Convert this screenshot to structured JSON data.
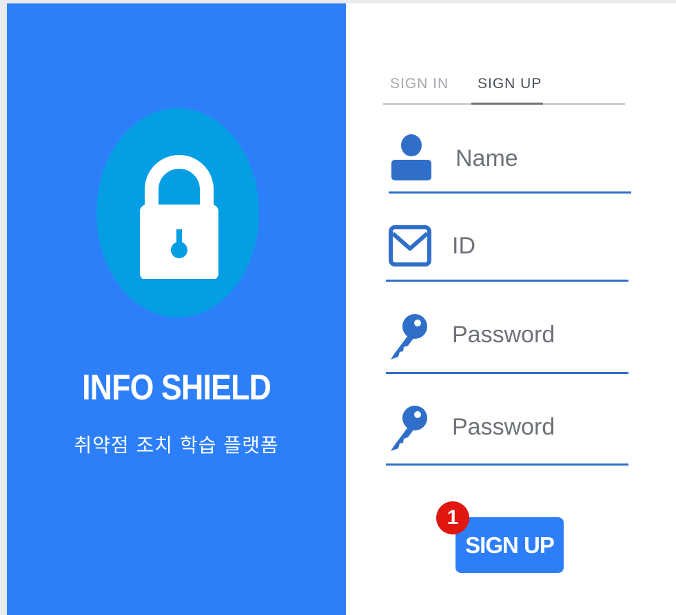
{
  "brand": {
    "title": "INFO SHIELD",
    "subtitle": "취약점 조치 학습 플랫폼",
    "icon": "lock-icon"
  },
  "tabs": [
    {
      "label": "SIGN  IN",
      "active": false
    },
    {
      "label": "SIGN  UP",
      "active": true
    }
  ],
  "form": {
    "name_label": "Name",
    "id_label": "ID",
    "password_label": "Password",
    "password_confirm_label": "Password",
    "submit_label": "SIGN UP"
  },
  "annotation": {
    "step": "1"
  },
  "colors": {
    "brand_blue": "#2d7ff9",
    "circle_blue": "#069ee3",
    "field_icon_blue": "#2f6fc9",
    "badge_red": "#e0170f"
  },
  "icons": {
    "name": "user-icon",
    "id": "envelope-icon",
    "password": "key-icon",
    "password_confirm": "key-icon"
  }
}
